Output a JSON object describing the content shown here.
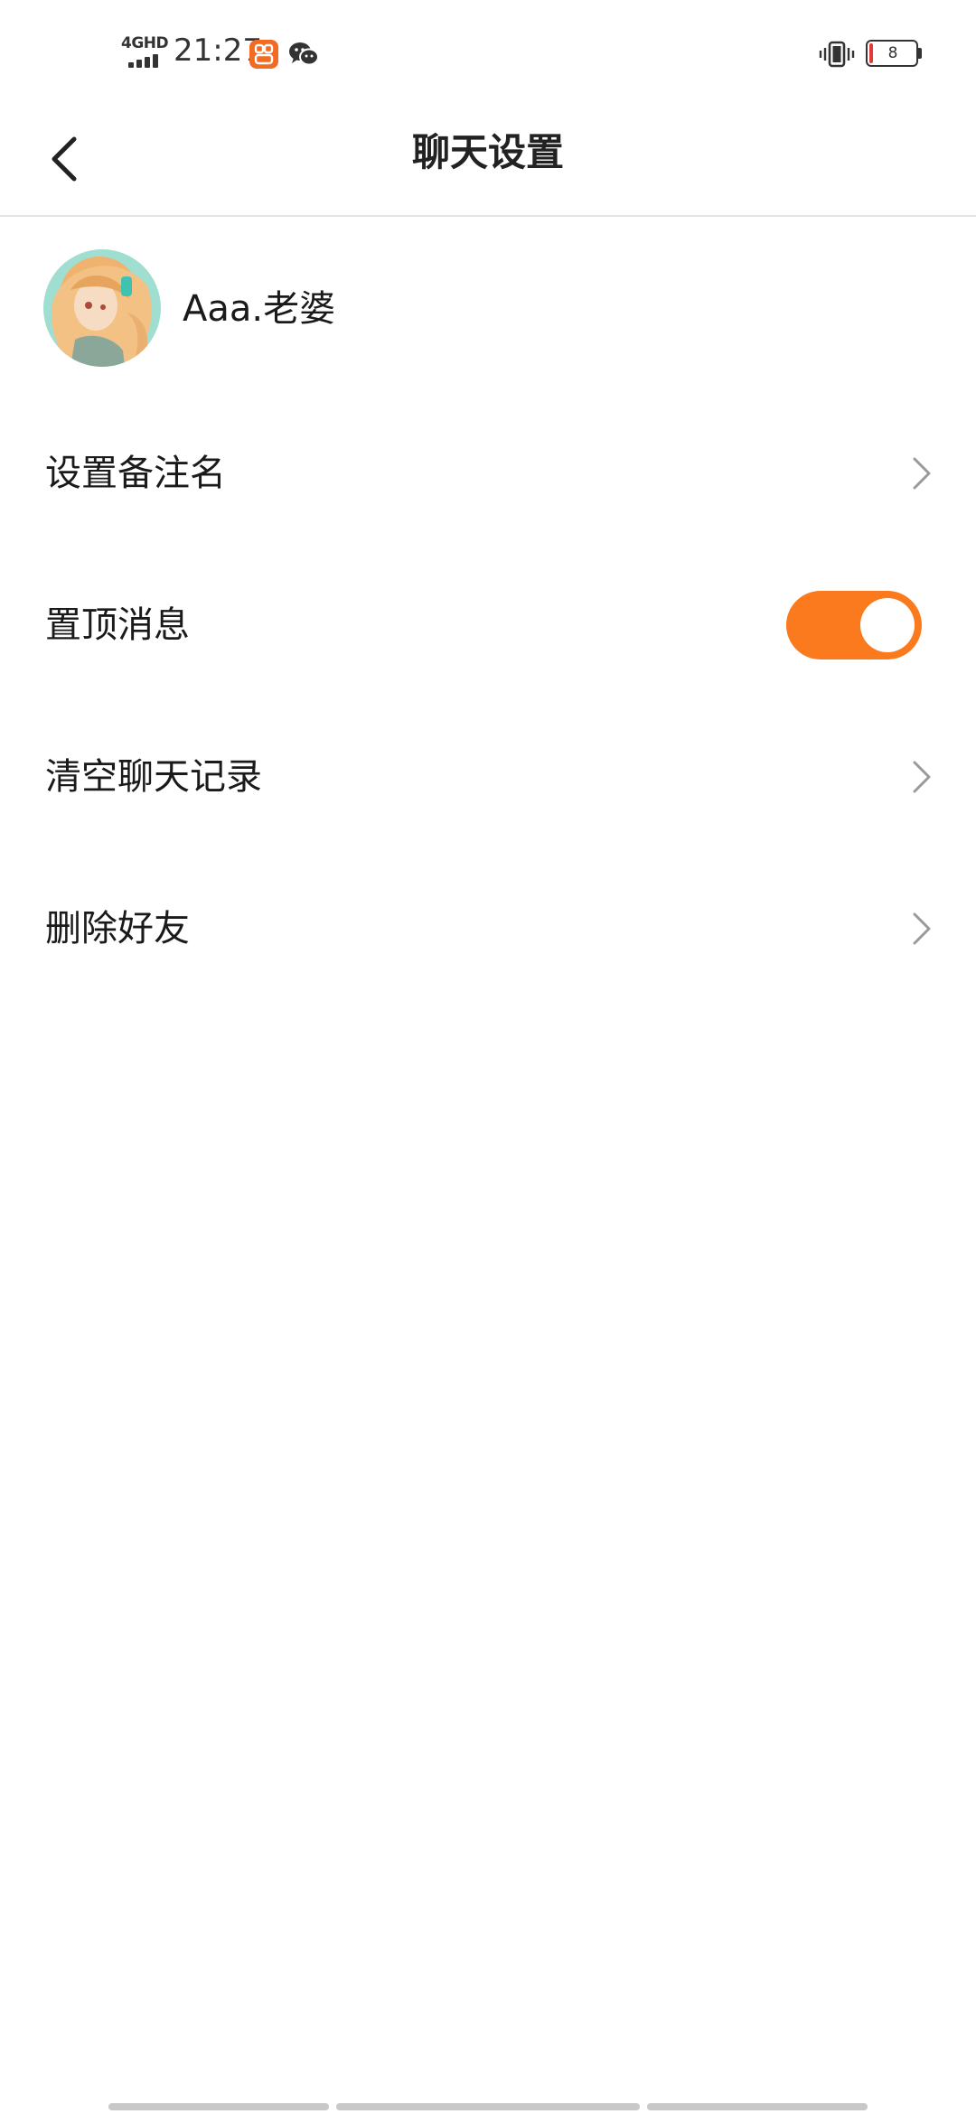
{
  "status_bar": {
    "network": "4GHD",
    "time": "21:27",
    "battery_level": "8",
    "icons": [
      "signal-icon",
      "app-notification-icon",
      "wechat-icon",
      "vibrate-icon",
      "battery-icon"
    ],
    "battery_color": "#e53935",
    "app_icon_color": "#f26b22"
  },
  "header": {
    "title": "聊天设置",
    "back_icon": "chevron-left-icon"
  },
  "profile": {
    "name": "Aaa.老婆",
    "avatar_icon": "avatar"
  },
  "settings": {
    "remark_label": "设置备注名",
    "pin_label": "置顶消息",
    "pin_enabled": true,
    "clear_history_label": "清空聊天记录",
    "delete_friend_label": "删除好友",
    "accent_color": "#fb7a1d"
  }
}
